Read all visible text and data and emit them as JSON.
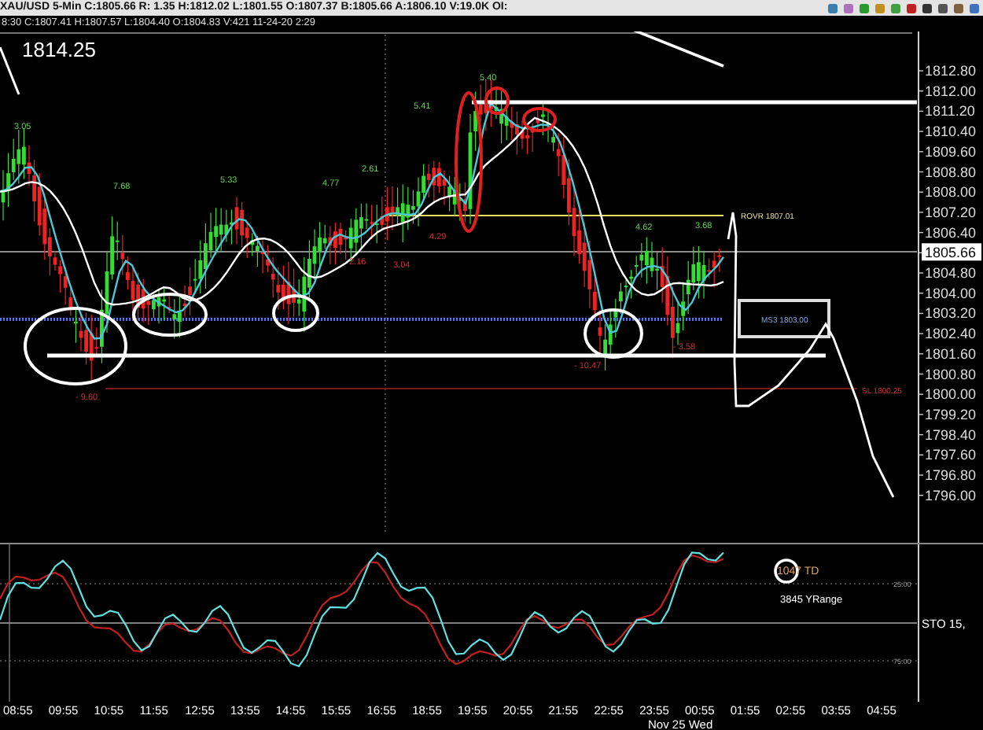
{
  "header": {
    "quote_line": "XAU/USD 5-Min  C:1805.66  R: 1.35  H:1812.02  L:1801.55  O:1807.37  B:1805.66  A:1806.10  V:19.0K  OI:",
    "bar_line": "8:30  C:1807.41  H:1807.57  L:1804.40  O:1804.83  V:421  11-24-20  2:29"
  },
  "price_chart": {
    "big_price": "1814.25",
    "y_axis_labels": [
      "1812.80",
      "1812.00",
      "1811.20",
      "1810.40",
      "1809.60",
      "1808.80",
      "1808.00",
      "1807.20",
      "1806.40",
      "1805.66",
      "1804.80",
      "1804.00",
      "1803.20",
      "1802.40",
      "1801.60",
      "1800.80",
      "1800.00",
      "1799.20",
      "1798.40",
      "1797.60",
      "1796.80",
      "1796.00"
    ],
    "swing_labels": [
      {
        "text": "3.05",
        "kind": "up"
      },
      {
        "text": "7.68",
        "kind": "up"
      },
      {
        "text": "5.33",
        "kind": "up"
      },
      {
        "text": "4.77",
        "kind": "up"
      },
      {
        "text": "2.61",
        "kind": "up"
      },
      {
        "text": "5.41",
        "kind": "up"
      },
      {
        "text": "5.40",
        "kind": "up"
      },
      {
        "text": "4.62",
        "kind": "up"
      },
      {
        "text": "3.68",
        "kind": "up"
      },
      {
        "text": "- 9.60",
        "kind": "down"
      },
      {
        "text": "2.16",
        "kind": "down"
      },
      {
        "text": "3.04",
        "kind": "down"
      },
      {
        "text": "4.29",
        "kind": "down"
      },
      {
        "text": "- 10.47",
        "kind": "down"
      },
      {
        "text": "- 3.58",
        "kind": "down"
      }
    ],
    "level_labels": [
      {
        "text": "ROVR 1807.01",
        "kind": "pivot"
      },
      {
        "text": "MS3 1803.00",
        "kind": "support"
      },
      {
        "text": "SL 1800.25",
        "kind": "stop"
      }
    ]
  },
  "indicator": {
    "td": "1047 TD",
    "yrange": "3845 YRange",
    "name": "STO  15,",
    "levels": [
      "25.00",
      "75.00"
    ]
  },
  "time_axis": {
    "labels": [
      "08:55",
      "09:55",
      "10:55",
      "11:55",
      "12:55",
      "13:55",
      "14:55",
      "15:55",
      "16:55",
      "18:55",
      "19:55",
      "20:55",
      "21:55",
      "22:55",
      "23:55",
      "00:55",
      "01:55",
      "02:55",
      "03:55",
      "04:55"
    ],
    "date": "Nov 25 Wed"
  }
}
